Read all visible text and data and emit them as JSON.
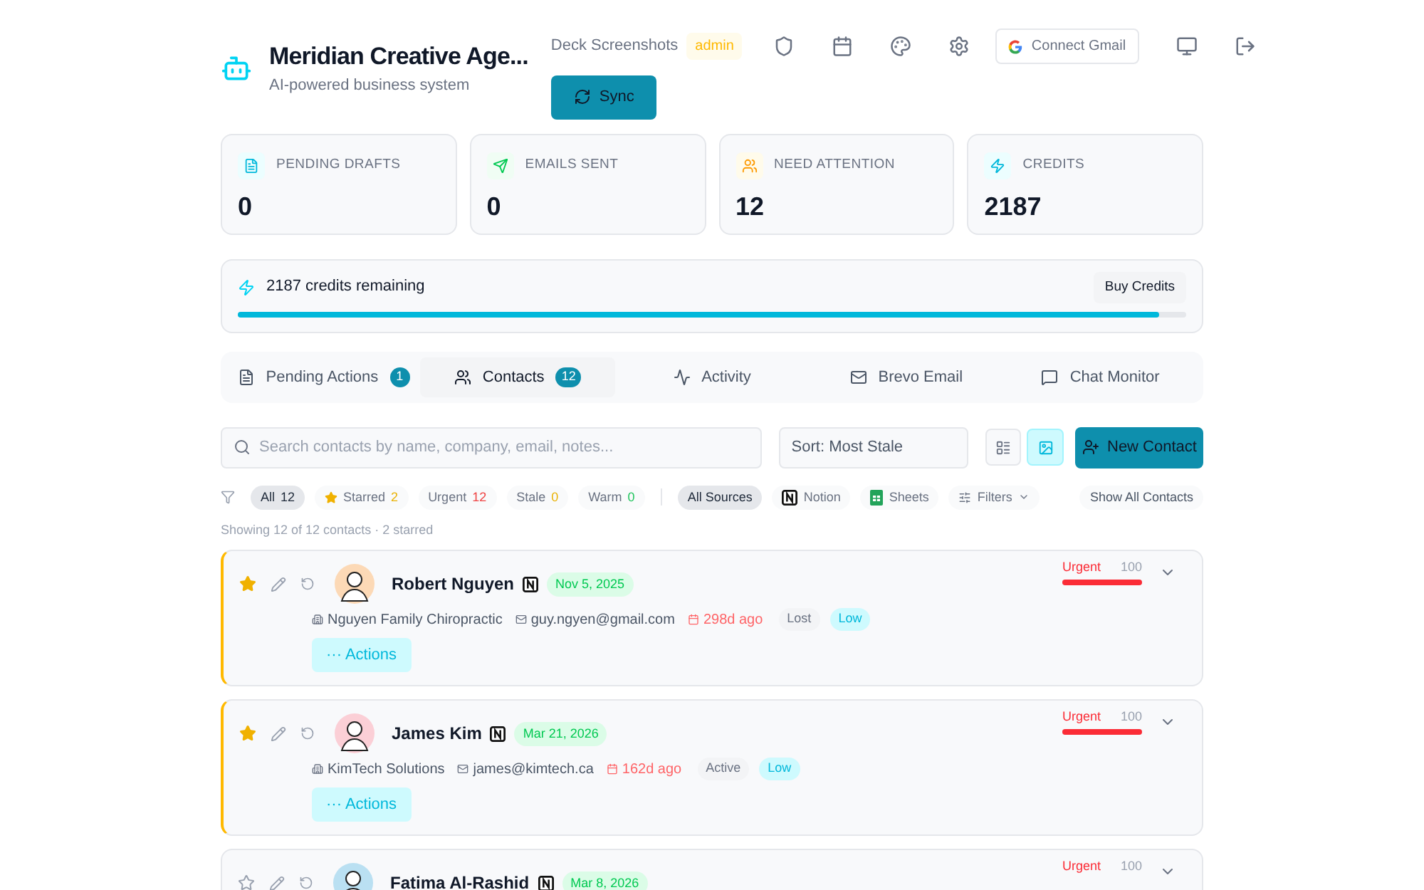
{
  "header": {
    "title": "Meridian Creative Age...",
    "subtitle": "AI-powered business system",
    "workspace": "Deck Screenshots",
    "role": "admin",
    "connect_label": "Connect Gmail",
    "sync_label": "Sync"
  },
  "stats": [
    {
      "kind": "drafts",
      "label": "PENDING DRAFTS",
      "value": "0"
    },
    {
      "kind": "sent",
      "label": "EMAILS SENT",
      "value": "0"
    },
    {
      "kind": "attention",
      "label": "NEED ATTENTION",
      "value": "12"
    },
    {
      "kind": "credits",
      "label": "CREDITS",
      "value": "2187"
    }
  ],
  "credits": {
    "text": "2187 credits remaining",
    "level": 0.971,
    "button": "Buy Credits"
  },
  "tabs": [
    {
      "kind": "pending",
      "label": "Pending Actions",
      "count": "1",
      "selected": false
    },
    {
      "kind": "contacts",
      "label": "Contacts",
      "count": "12",
      "selected": true
    },
    {
      "kind": "activity",
      "label": "Activity",
      "selected": false
    },
    {
      "kind": "email",
      "label": "Brevo Email",
      "selected": false
    },
    {
      "kind": "chat",
      "label": "Chat Monitor",
      "selected": false
    }
  ],
  "search": {
    "placeholder": "Search contacts by name, company, email, notes..."
  },
  "sort": {
    "value": "Sort: Most Stale"
  },
  "view_toggle": [
    {
      "kind": "list",
      "selected": false
    },
    {
      "kind": "cards",
      "selected": true
    }
  ],
  "new_contact": "New Contact",
  "filters": [
    {
      "kind": "plain",
      "label": "All",
      "count": "12",
      "selected": true
    },
    {
      "kind": "star",
      "label": "Starred",
      "count": "2",
      "color": "#eab308",
      "selected": false
    },
    {
      "kind": "plain",
      "label": "Urgent",
      "count": "12",
      "color": "#ef4444",
      "selected": false
    },
    {
      "kind": "plain",
      "label": "Stale",
      "count": "0",
      "color": "#eab308",
      "selected": false
    },
    {
      "kind": "plain",
      "label": "Warm",
      "count": "0",
      "color": "#22c55e",
      "selected": false
    }
  ],
  "sources": [
    {
      "kind": "all",
      "label": "All Sources",
      "selected": true
    },
    {
      "kind": "notion",
      "label": "Notion",
      "selected": false
    },
    {
      "kind": "sheets",
      "label": "Sheets",
      "selected": false
    },
    {
      "kind": "filters",
      "label": "Filters",
      "selected": false
    }
  ],
  "show_all": "Show All Contacts",
  "summary": "Showing 12 of 12 contacts · 2 starred",
  "contacts": [
    {
      "name": "Robert Nguyen",
      "starred": true,
      "color": "#fcd9b6",
      "date": "Nov 5, 2025",
      "company": "Nguyen Family Chiropractic",
      "email": "guy.ngyen@gmail.com",
      "stale": "298d ago",
      "status": "Lost",
      "priority": "Low",
      "actions": "··· Actions",
      "urgency": "Urgent",
      "score": "100",
      "level": 1
    },
    {
      "name": "James Kim",
      "starred": true,
      "color": "#fbcfd6",
      "date": "Mar 21, 2026",
      "company": "KimTech Solutions",
      "email": "james@kimtech.ca",
      "stale": "162d ago",
      "status": "Active",
      "priority": "Low",
      "actions": "··· Actions",
      "urgency": "Urgent",
      "score": "100",
      "level": 1
    },
    {
      "name": "Fatima Al-Rashid",
      "starred": false,
      "color": "#bae0f2",
      "date": "Mar 8, 2026",
      "urgency": "Urgent",
      "score": "100"
    }
  ]
}
